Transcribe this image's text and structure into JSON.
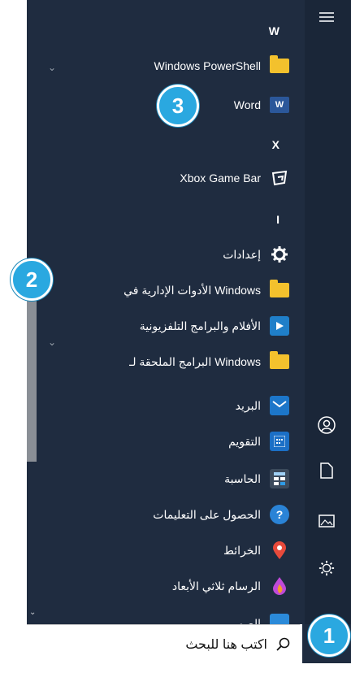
{
  "menu": {
    "letters": {
      "w": "W",
      "x": "X",
      "i": "I"
    },
    "items": [
      {
        "label": "Windows PowerShell",
        "icon": "folder-icon"
      },
      {
        "label": "Word",
        "icon": "word-icon"
      },
      {
        "label": "Xbox Game Bar",
        "icon": "xbox-game-bar-icon"
      },
      {
        "label": "إعدادات",
        "icon": "gear-icon"
      },
      {
        "label": "الأدوات الإدارية في Windows",
        "icon": "folder-icon"
      },
      {
        "label": "الأفلام والبرامج التلفزيونية",
        "icon": "movies-tv-icon"
      },
      {
        "label": "البرامج الملحقة لـ Windows",
        "icon": "folder-icon"
      },
      {
        "label": "البريد",
        "icon": "mail-icon"
      },
      {
        "label": "التقويم",
        "icon": "calendar-icon"
      },
      {
        "label": "الحاسبة",
        "icon": "calculator-icon"
      },
      {
        "label": "الحصول على التعليمات",
        "icon": "help-icon"
      },
      {
        "label": "الخرائط",
        "icon": "maps-icon"
      },
      {
        "label": "الرسام ثلاثي الأبعاد",
        "icon": "paint3d-icon"
      },
      {
        "label": "الصور",
        "icon": "photos-icon"
      }
    ]
  },
  "callouts": [
    "1",
    "2",
    "3"
  ],
  "search": {
    "placeholder": "اكتب هنا للبحث"
  },
  "colors": {
    "menu_bg": "#1f2c40",
    "callout": "#2aa8e0",
    "folder": "#f3c12d"
  }
}
